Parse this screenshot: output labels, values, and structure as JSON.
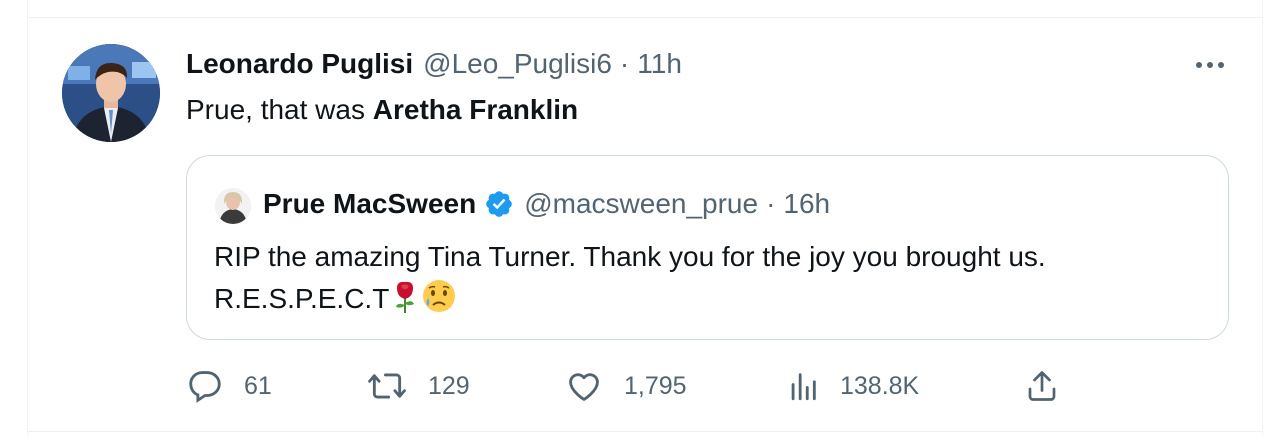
{
  "tweet": {
    "author_name": "Leonardo Puglisi",
    "author_handle": "@Leo_Puglisi6",
    "separator": "·",
    "time": "11h",
    "text_before": "Prue, that was ",
    "text_bold": "Aretha Franklin",
    "more_icon": "ellipsis-icon"
  },
  "quote": {
    "author_name": "Prue MacSween",
    "verified_icon": "verified-badge-icon",
    "author_handle": "@macsween_prue",
    "separator": "·",
    "time": "16h",
    "text_line1": "RIP the amazing Tina Turner. Thank you for the joy you brought us.",
    "text_line2": "R.E.S.P.E.C.T",
    "emojis": [
      "rose-emoji",
      "crying-face-emoji"
    ]
  },
  "actions": {
    "reply_count": "61",
    "retweet_count": "129",
    "like_count": "1,795",
    "views_count": "138.8K",
    "icons": [
      "reply-icon",
      "retweet-icon",
      "like-icon",
      "views-icon",
      "share-icon"
    ]
  },
  "colors": {
    "text": "#0f1419",
    "muted": "#536471",
    "border": "#cfd9de",
    "verified": "#1d9bf0"
  }
}
